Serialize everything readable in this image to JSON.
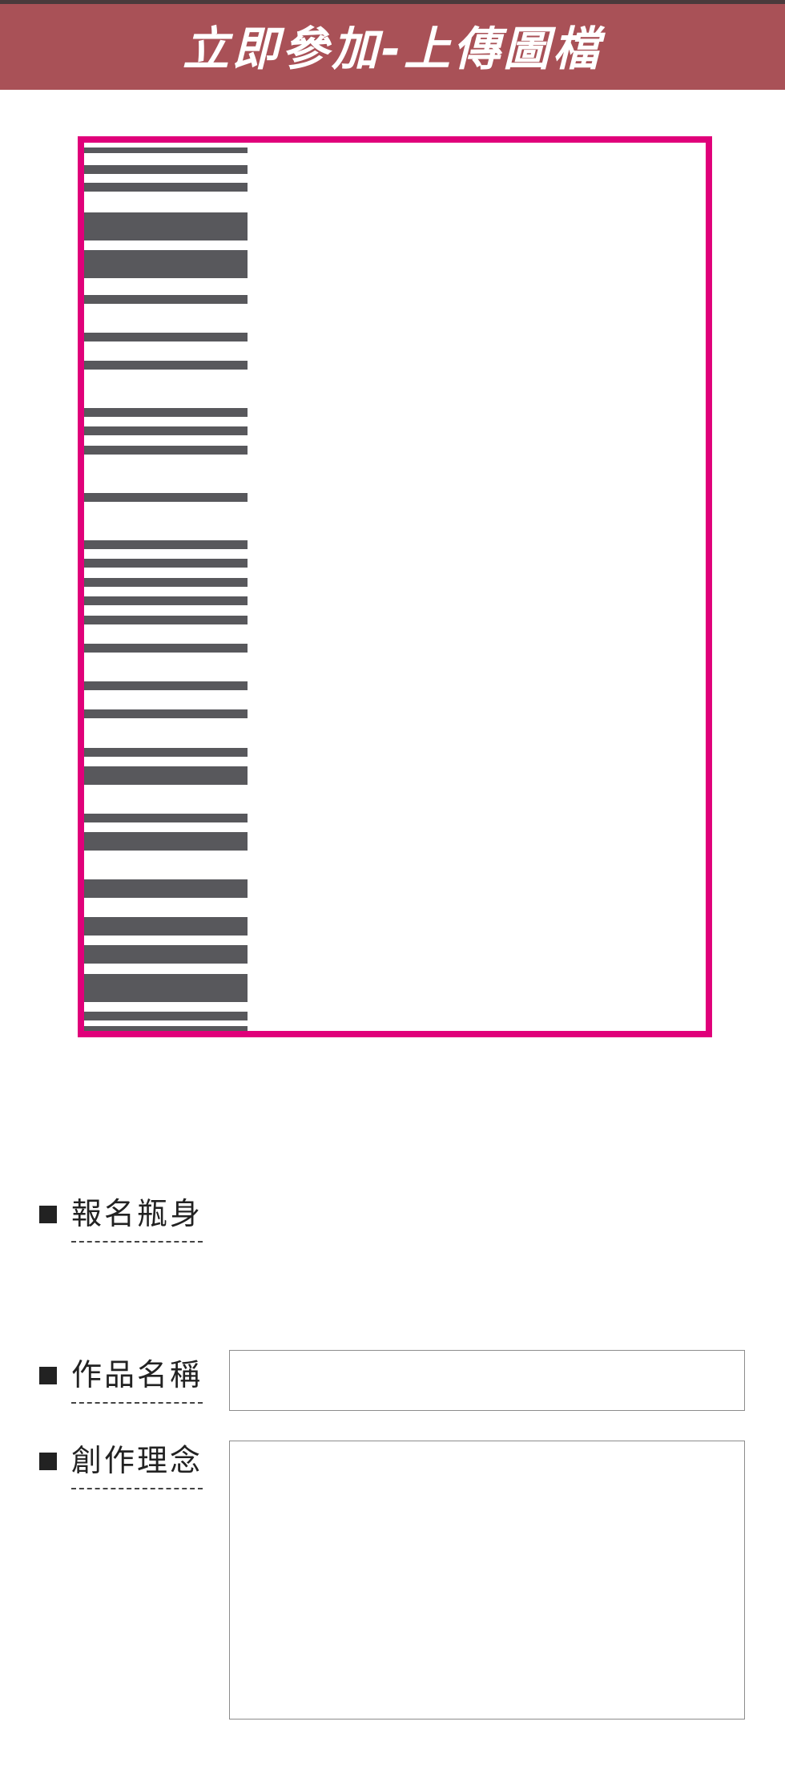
{
  "header": {
    "title": "立即參加-上傳圖檔",
    "background_color": "#a95157"
  },
  "upload_area": {
    "border_color": "#e0007a",
    "content": "barcode-like bottle label preview"
  },
  "form": {
    "entry_bottle_label": "報名瓶身",
    "work_name_label": "作品名稱",
    "work_name_value": "",
    "concept_label": "創作理念",
    "concept_value": ""
  }
}
